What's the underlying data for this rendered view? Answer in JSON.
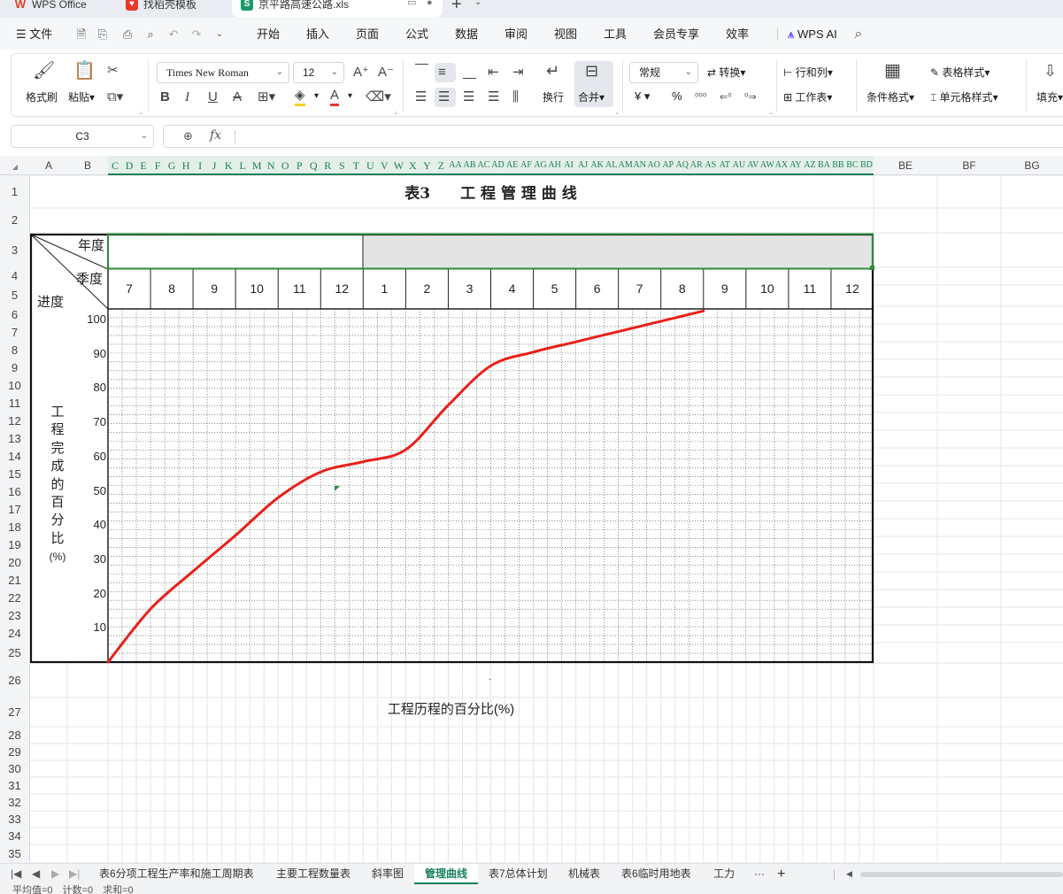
{
  "app": {
    "tabs": [
      {
        "label": "WPS Office",
        "icon": "wps-logo-icon",
        "color": "#e8392a"
      },
      {
        "label": "找稻壳模板",
        "icon": "docer-icon",
        "color": "#e8392a"
      },
      {
        "label": "京平路高速公路.xls",
        "icon": "spreadsheet-icon",
        "color": "#1b9b6a",
        "badge": "S"
      }
    ]
  },
  "menu": {
    "file": "文件",
    "items": [
      "开始",
      "插入",
      "页面",
      "公式",
      "数据",
      "审阅",
      "视图",
      "工具",
      "会员专享",
      "效率"
    ],
    "active": "开始",
    "ai": "WPS AI"
  },
  "ribbon": {
    "format_painter": "格式刷",
    "paste": "粘贴",
    "font_name": "Times New Roman",
    "font_size": "12",
    "wrap": "换行",
    "merge": "合并",
    "number_format": "常规",
    "convert": "转换",
    "row_col": "行和列",
    "worksheet": "工作表",
    "cond_format": "条件格式",
    "table_style": "表格样式",
    "cell_style": "单元格样式",
    "fill": "填充",
    "currency": "¥",
    "percent": "%"
  },
  "formula_bar": {
    "cell_ref": "C3",
    "content": ""
  },
  "sheet": {
    "columns_left": [
      "A",
      "B"
    ],
    "columns_narrow": [
      "C",
      "D",
      "E",
      "F",
      "G",
      "H",
      "I",
      "J",
      "K",
      "L",
      "M",
      "N",
      "O",
      "P",
      "Q",
      "R",
      "S",
      "T",
      "U",
      "V",
      "W",
      "X",
      "Y",
      "Z",
      "AA",
      "AB",
      "AC",
      "AD",
      "AE",
      "AF",
      "AG",
      "AH",
      "AI",
      "AJ",
      "AK",
      "AL",
      "AM",
      "AN",
      "AO",
      "AP",
      "AQ",
      "AR",
      "AS",
      "AT",
      "AU",
      "AV",
      "AW",
      "AX",
      "AY",
      "AZ",
      "BA",
      "BB",
      "BC",
      "BD"
    ],
    "columns_right": [
      "BE",
      "BF",
      "BG"
    ],
    "rows": [
      "1",
      "2",
      "3",
      "4",
      "5",
      "6",
      "7",
      "8",
      "9",
      "10",
      "11",
      "12",
      "13",
      "14",
      "15",
      "16",
      "17",
      "18",
      "19",
      "20",
      "21",
      "22",
      "23",
      "24",
      "25",
      "26",
      "27",
      "28",
      "29",
      "30",
      "31",
      "32",
      "33",
      "34",
      "35"
    ],
    "title": "表3　　工 程 管 理 曲 线",
    "header_year": "年度",
    "header_quarter": "季度",
    "header_progress": "进度",
    "y_label": [
      "工",
      "程",
      "完",
      "成",
      "的",
      "百",
      "分",
      "比",
      "(%)"
    ],
    "x_label": "工程历程的百分比(%)",
    "stray_dot": "."
  },
  "chart_data": {
    "type": "line",
    "categories": [
      "7",
      "8",
      "9",
      "10",
      "11",
      "12",
      "1",
      "2",
      "3",
      "4",
      "5",
      "6",
      "7",
      "8",
      "9",
      "10",
      "11",
      "12"
    ],
    "y_ticks": [
      10,
      20,
      30,
      40,
      50,
      60,
      70,
      80,
      90,
      100
    ],
    "ylim": [
      0,
      100
    ],
    "line_color": "#e8201a",
    "series": [
      {
        "x": [
          0,
          1,
          2,
          3,
          4,
          5,
          6,
          7,
          8,
          9,
          10,
          11,
          12,
          13,
          14
        ],
        "y": [
          0,
          15.5,
          26.5,
          37,
          48,
          55.5,
          58.5,
          62,
          75,
          86.5,
          90.5,
          93.5,
          96.5,
          99.5,
          102.5
        ]
      }
    ]
  },
  "sheet_tabs": {
    "tabs": [
      "表6分项工程生产率和施工周期表",
      "主要工程数量表",
      "斜率图",
      "管理曲线",
      "表7总体计划",
      "机械表",
      "表6临时用地表",
      "工力"
    ],
    "active": "管理曲线",
    "more": "···",
    "add": "+"
  },
  "status": {
    "text": "平均值=0　计数=0　求和=0"
  }
}
